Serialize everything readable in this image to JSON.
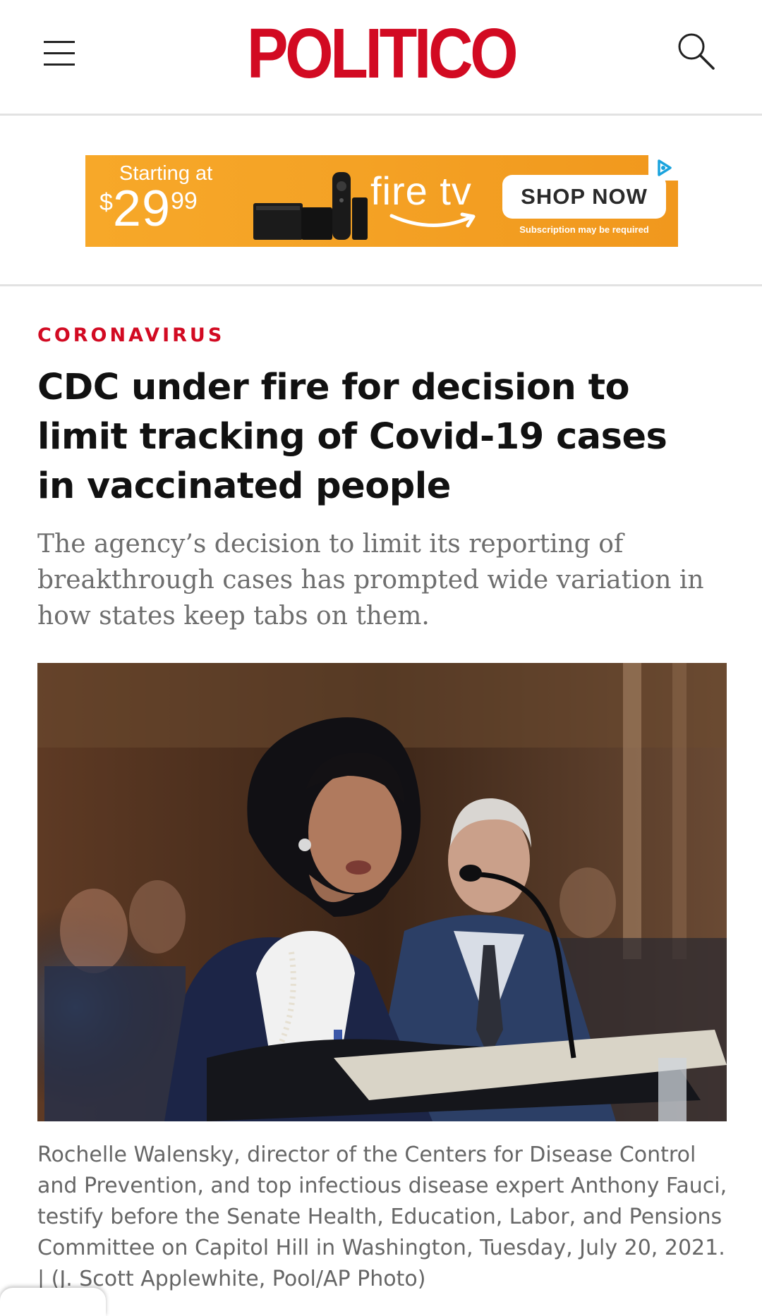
{
  "header": {
    "logo": "POLITICO",
    "menu_icon": "hamburger-menu-icon",
    "search_icon": "search-icon",
    "brand_color": "#d20a22"
  },
  "ad": {
    "starting_text": "Starting at",
    "price_currency": "$",
    "price_dollars": "29",
    "price_cents": "99",
    "brand": "fire tv",
    "cta": "SHOP NOW",
    "fine_print": "Subscription may be required",
    "adchoices_icon": "adchoices-icon",
    "background_color": "#f4a225"
  },
  "article": {
    "kicker": "CORONAVIRUS",
    "headline": "CDC under fire for decision to limit tracking of Covid-19 cases in vaccinated people",
    "dek": "The agency’s decision to limit its reporting of breakthrough cases has prompted wide variation in how states keep tabs on them.",
    "caption": "Rochelle Walensky, director of the Centers for Disease Control and Prevention, and top infectious disease expert Anthony Fauci, testify before the Senate Health, Education, Labor, and Pensions Committee on Capitol Hill in Washington, Tuesday, July 20, 2021. | (J. Scott Applewhite, Pool/AP Photo)"
  }
}
